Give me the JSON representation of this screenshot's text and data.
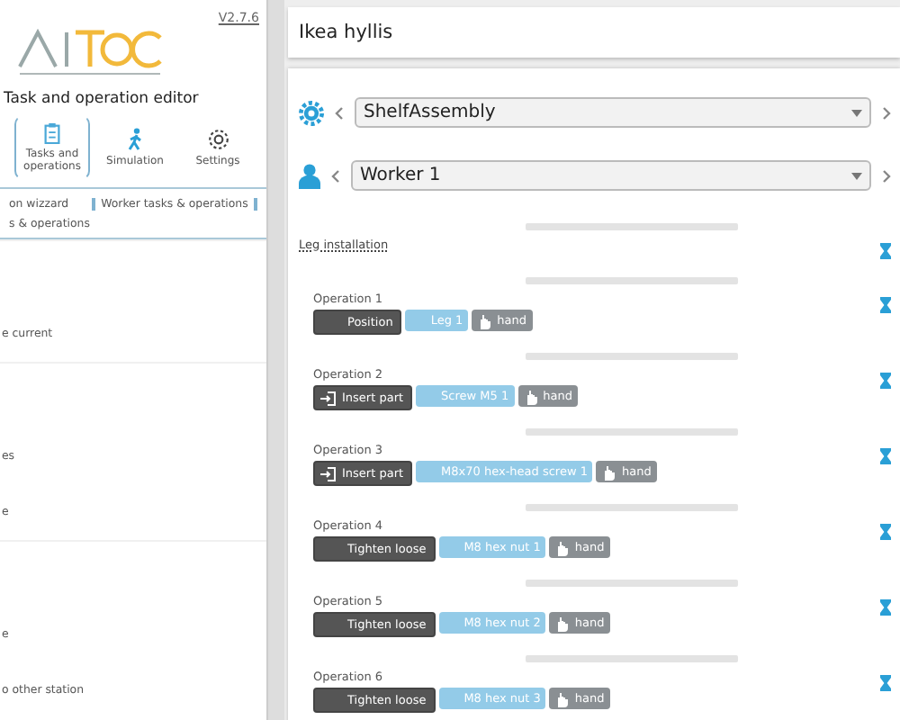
{
  "sidebar": {
    "version": "V2.7.6",
    "title": "Task and operation editor",
    "nav": [
      {
        "label": "Tasks and operations",
        "selected": true
      },
      {
        "label": "Simulation",
        "selected": false
      },
      {
        "label": "Settings",
        "selected": false
      }
    ],
    "subtabs": [
      {
        "label": "on wizzard",
        "selected": false
      },
      {
        "label": "Worker tasks & operations",
        "selected": true
      },
      {
        "label": "s & operations",
        "selected": false
      }
    ],
    "sections": [
      [
        {
          "text": "e current"
        }
      ],
      [
        {
          "text": "es"
        },
        {
          "text": "e"
        }
      ],
      [
        {
          "text": "e"
        },
        {
          "text": "o other station"
        }
      ]
    ]
  },
  "header": {
    "title": "Ikea hyllis"
  },
  "selectors": [
    {
      "value": "ShelfAssembly"
    },
    {
      "value": "Worker 1"
    }
  ],
  "task": {
    "name": "Leg installation"
  },
  "operations": [
    {
      "name": "Operation 1",
      "tags": [
        {
          "kind": "action",
          "text": "Position"
        },
        {
          "kind": "part",
          "text": "Leg 1"
        },
        {
          "kind": "tool",
          "text": "hand"
        }
      ]
    },
    {
      "name": "Operation 2",
      "tags": [
        {
          "kind": "insert",
          "text": "Insert part"
        },
        {
          "kind": "part",
          "text": "Screw M5 1"
        },
        {
          "kind": "tool",
          "text": "hand"
        }
      ]
    },
    {
      "name": "Operation 3",
      "tags": [
        {
          "kind": "insert",
          "text": "Insert part"
        },
        {
          "kind": "part",
          "text": "M8x70 hex-head screw 1"
        },
        {
          "kind": "tool",
          "text": "hand"
        }
      ]
    },
    {
      "name": "Operation 4",
      "tags": [
        {
          "kind": "action",
          "text": "Tighten loose"
        },
        {
          "kind": "part",
          "text": "M8 hex nut 1"
        },
        {
          "kind": "tool",
          "text": "hand"
        }
      ]
    },
    {
      "name": "Operation 5",
      "tags": [
        {
          "kind": "action",
          "text": "Tighten loose"
        },
        {
          "kind": "part",
          "text": "M8 hex nut 2"
        },
        {
          "kind": "tool",
          "text": "hand"
        }
      ]
    },
    {
      "name": "Operation 6",
      "tags": [
        {
          "kind": "action",
          "text": "Tighten loose"
        },
        {
          "kind": "part",
          "text": "M8 hex nut 3"
        },
        {
          "kind": "tool",
          "text": "hand"
        }
      ]
    }
  ]
}
